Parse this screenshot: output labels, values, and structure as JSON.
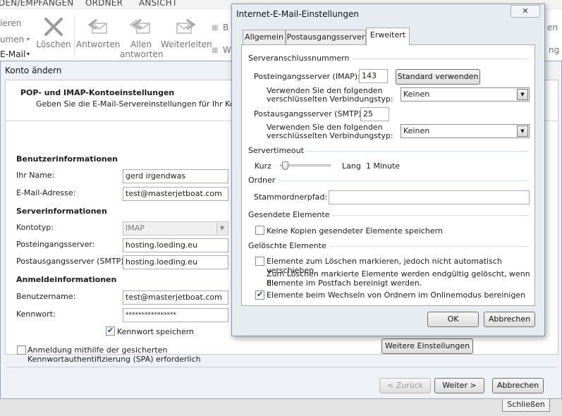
{
  "ribbon": {
    "tabs": [
      "DEN/EMPFANGEN",
      "ORDNER",
      "ANSICHT"
    ],
    "left_fragments": [
      "ieren",
      "umen",
      "E-Mail"
    ],
    "buttons": {
      "loeschen": "Löschen",
      "antworten": "Antworten",
      "allen_line1": "Allen",
      "allen_line2": "antworten",
      "weiterleiten": "Weiterleiten"
    },
    "right_fragments": [
      "B",
      "W",
      "en",
      "ng"
    ]
  },
  "background": {
    "schliessen": "Schließen"
  },
  "konto": {
    "title": "Konto ändern",
    "header_title": "POP- und IMAP-Kontoeinstellungen",
    "header_sub": "Geben Sie die E-Mail-Servereinstellungen für Ihr Konto ein",
    "sections": {
      "user": "Benutzerinformationen",
      "server": "Serverinformationen",
      "login": "Anmeldeinformationen"
    },
    "labels": {
      "name": "Ihr Name:",
      "email": "E-Mail-Adresse:",
      "account_type": "Kontotyp:",
      "incoming": "Posteingangsserver:",
      "outgoing": "Postausgangsserver (SMTP):",
      "username": "Benutzername:",
      "password": "Kennwort:"
    },
    "values": {
      "name": "gerd irgendwas",
      "email": "test@masterjetboat.com",
      "account_type": "IMAP",
      "incoming": "hosting.loeding.eu",
      "outgoing": "hosting.loeding.eu",
      "username": "test@masterjetboat.com",
      "password": "****************"
    },
    "remember_password": {
      "label": "Kennwort speichern",
      "checked": true
    },
    "spa": {
      "line1": "Anmeldung mithilfe der gesicherten",
      "line2": "Kennwortauthentifizierung (SPA) erforderlich",
      "checked": false
    },
    "more_settings": "Weitere Einstellungen",
    "back": "< Zurück",
    "next": "Weiter >",
    "cancel": "Abbrechen"
  },
  "inet": {
    "title": "Internet-E-Mail-Einstellungen",
    "close_glyph": "✕",
    "tabs": [
      "Allgemein",
      "Postausgangsserver",
      "Erweitert"
    ],
    "active_tab": "Erweitert",
    "groups": {
      "ports": "Serveranschlussnummern",
      "timeout": "Servertimeout",
      "folders": "Ordner",
      "sent": "Gesendete Elemente",
      "deleted": "Gelöschte Elemente"
    },
    "imap_label": "Posteingangsserver (IMAP):",
    "imap_port": "143",
    "standard_button": "Standard verwenden",
    "enc_label_line1": "Verwenden Sie den folgenden",
    "enc_label_line2": "verschlüsselten Verbindungstyp:",
    "imap_enc": "Keinen",
    "smtp_label": "Postausgangsserver (SMTP):",
    "smtp_port": "25",
    "smtp_enc": "Keinen",
    "timeout_short": "Kurz",
    "timeout_long": "Lang",
    "timeout_value": "1 Minute",
    "timeout_level": 0.05,
    "root_folder_label": "Stammordnerpfad:",
    "root_folder_value": "",
    "no_copies": {
      "label": "Keine Kopien gesendeter Elemente speichern",
      "checked": false
    },
    "mark_delete": {
      "label": "Elemente zum Löschen markieren, jedoch nicht automatisch verschieben",
      "checked": false
    },
    "mark_delete_note1": "Zum Löschen markierte Elemente werden endgültig gelöscht, wenn die",
    "mark_delete_note2": "Elemente im Postfach bereinigt werden.",
    "purge": {
      "label": "Elemente beim Wechseln von Ordnern im Onlinemodus bereinigen",
      "checked": true
    },
    "ok": "OK",
    "cancel": "Abbrechen"
  }
}
